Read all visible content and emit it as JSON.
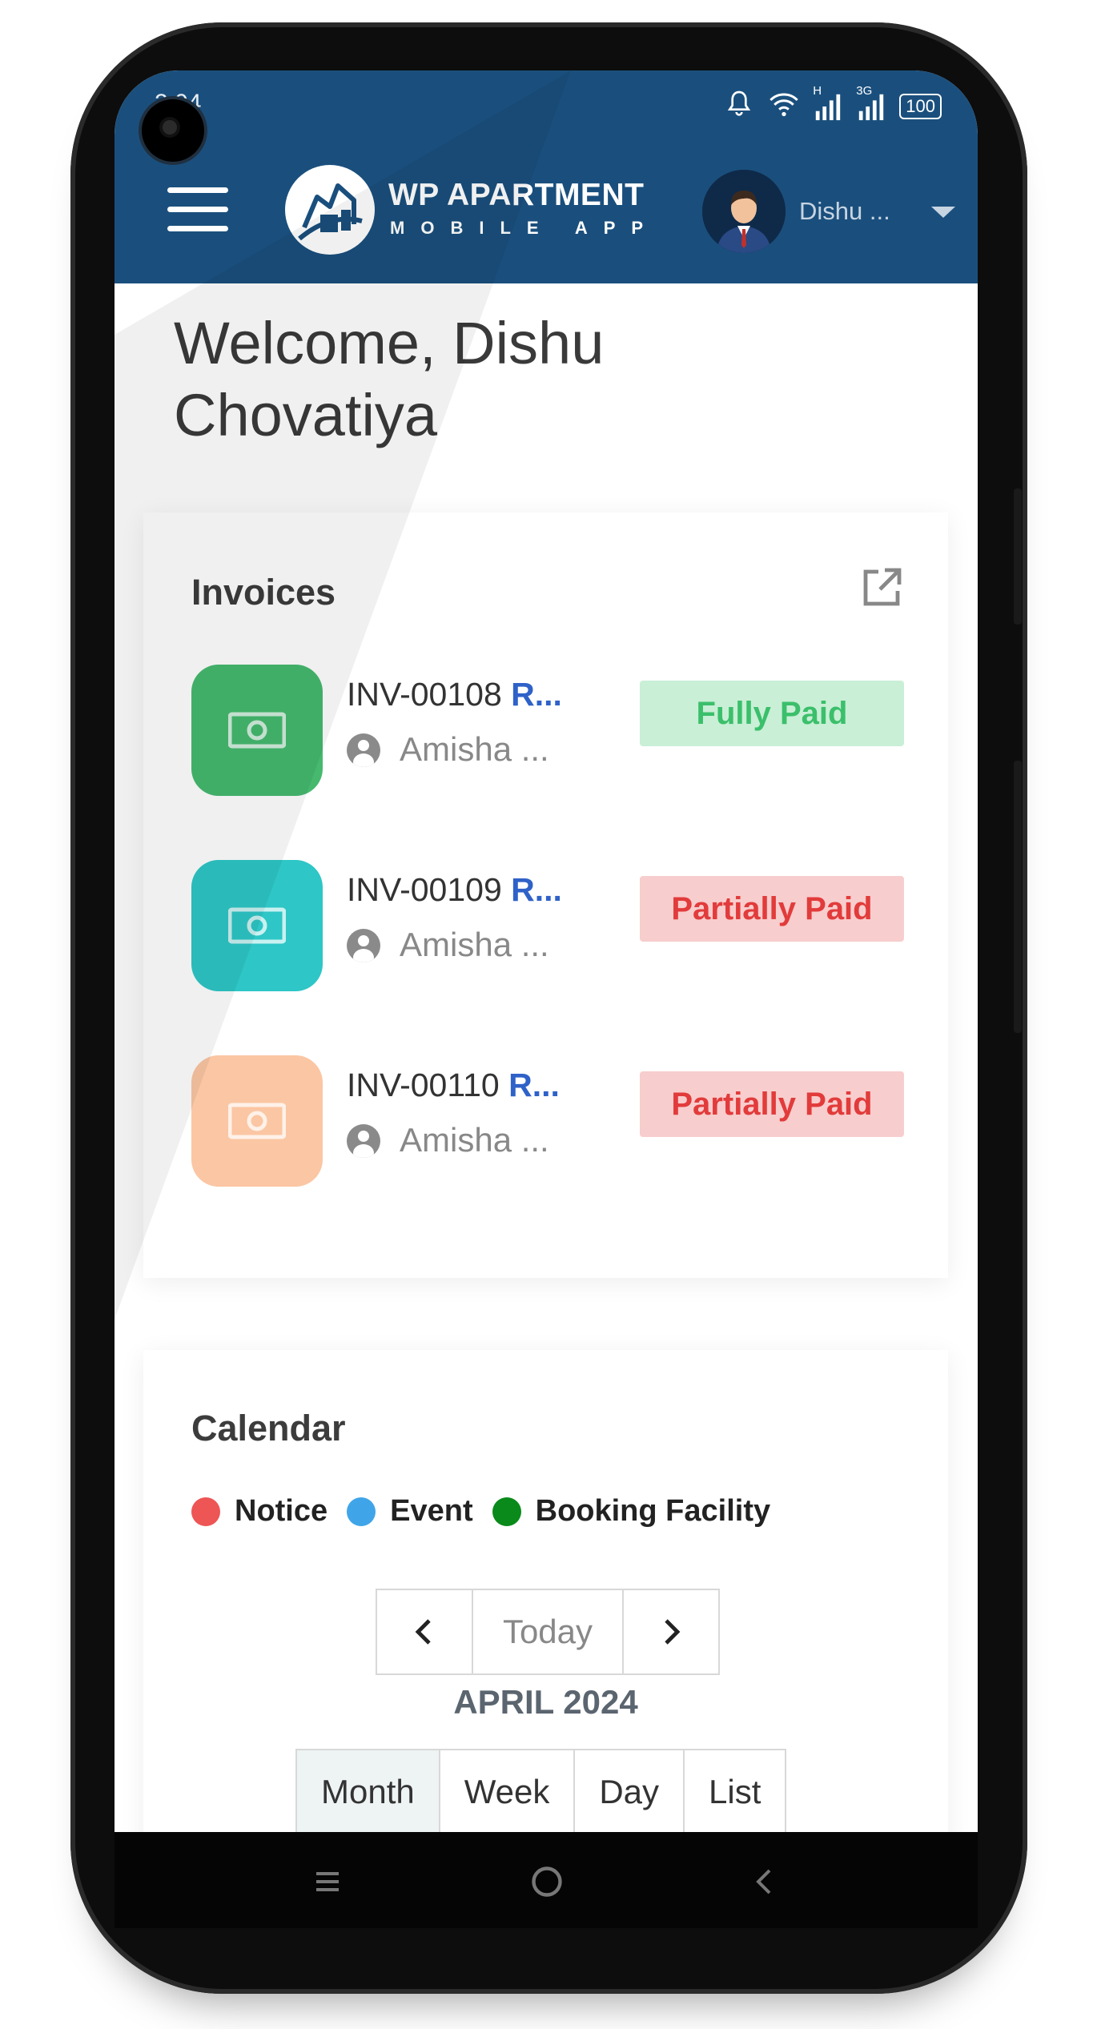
{
  "status_bar": {
    "time": "2:04",
    "battery": "100",
    "signal_label": "H",
    "signal2_label": "3G"
  },
  "header": {
    "brand_title": "WP APARTMENT",
    "brand_subtitle": "MOBILE APP",
    "user_name": "Dishu ...",
    "color": "#1a4f7d"
  },
  "welcome": {
    "text": "Welcome, Dishu Chovatiya"
  },
  "invoices": {
    "title": "Invoices",
    "items": [
      {
        "id": "INV-00108",
        "suffix": "R...",
        "person": "Amisha ...",
        "status": "Fully Paid",
        "icon_color": "#46b96f",
        "badge_bg": "#c9efd6",
        "badge_color": "#3bbf6b"
      },
      {
        "id": "INV-00109",
        "suffix": "R...",
        "person": "Amisha ...",
        "status": "Partially Paid",
        "icon_color": "#2ec6c6",
        "badge_bg": "#f8cdcd",
        "badge_color": "#e23b3b"
      },
      {
        "id": "INV-00110",
        "suffix": "R...",
        "person": "Amisha ...",
        "status": "Partially Paid",
        "icon_color": "#fbc6a3",
        "badge_bg": "#f8cdcd",
        "badge_color": "#e23b3b"
      }
    ]
  },
  "calendar": {
    "title": "Calendar",
    "legend": [
      {
        "label": "Notice",
        "color": "#ee5555"
      },
      {
        "label": "Event",
        "color": "#3fa5e8"
      },
      {
        "label": "Booking Facility",
        "color": "#0a8a1a"
      }
    ],
    "today_label": "Today",
    "month_label": "APRIL 2024",
    "views": [
      "Month",
      "Week",
      "Day",
      "List"
    ],
    "active_view": "Month"
  },
  "icons": [
    "menu-icon",
    "logo-icon",
    "avatar",
    "chevron-down-icon",
    "external-link-icon",
    "money-icon",
    "user-icon",
    "chevron-left-icon",
    "chevron-right-icon",
    "home-nav-icon",
    "back-nav-icon",
    "recent-apps-icon"
  ]
}
